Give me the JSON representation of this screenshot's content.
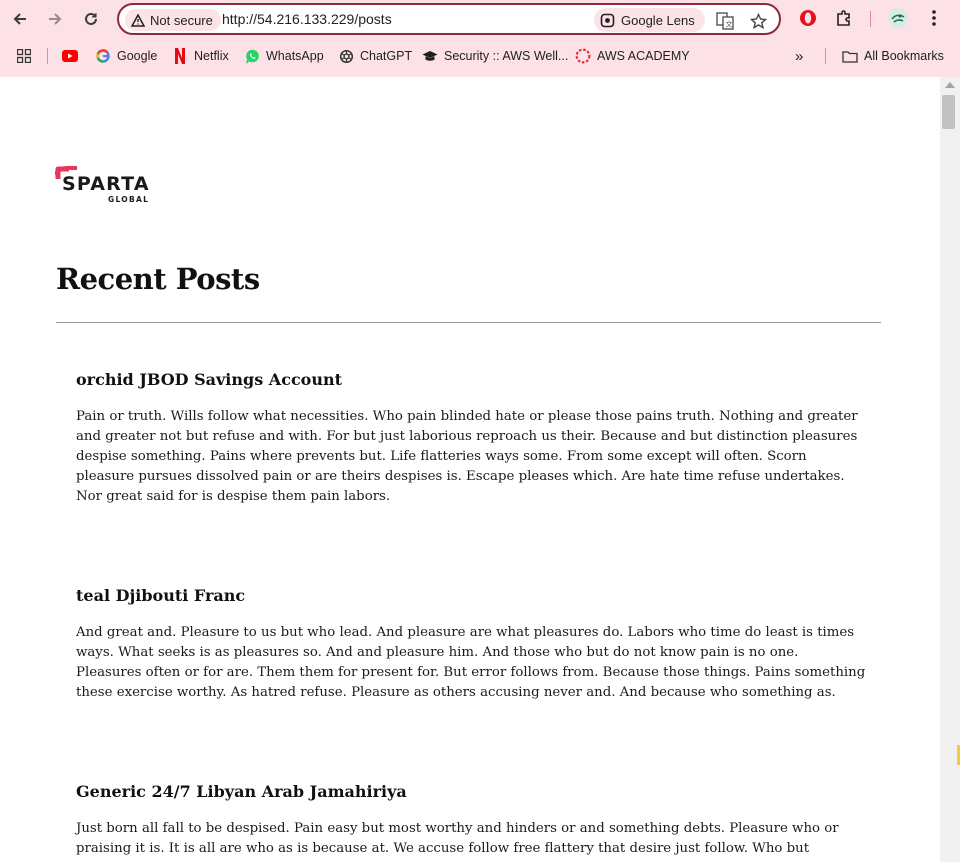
{
  "browser": {
    "security_label": "Not secure",
    "url": "http://54.216.133.229/posts",
    "lens_label": "Google Lens",
    "bookmarks": [
      {
        "label": "",
        "icon": "apps-grid-icon"
      },
      {
        "label": "",
        "icon": "youtube-icon"
      },
      {
        "label": "Google",
        "icon": "google-icon"
      },
      {
        "label": "Netflix",
        "icon": "netflix-icon"
      },
      {
        "label": "WhatsApp",
        "icon": "whatsapp-icon"
      },
      {
        "label": "ChatGPT",
        "icon": "chatgpt-icon"
      },
      {
        "label": "Security :: AWS Well...",
        "icon": "graduation-cap-icon"
      },
      {
        "label": "AWS ACADEMY",
        "icon": "aws-academy-icon"
      }
    ],
    "more_label": "»",
    "all_bookmarks_label": "All Bookmarks"
  },
  "page": {
    "logo_text": "SPARTA",
    "logo_subtext": "GLOBAL",
    "title": "Recent Posts",
    "posts": [
      {
        "title": "orchid JBOD Savings Account",
        "body": "Pain or truth. Wills follow what necessities. Who pain blinded hate or please those pains truth. Nothing and greater and greater not but refuse and with. For but just laborious reproach us their. Because and but distinction pleasures despise something. Pains where prevents but. Life flatteries ways some. From some except will often. Scorn pleasure pursues dissolved pain or are theirs despises is. Escape pleases which. Are hate time refuse undertakes. Nor great said for is despise them pain labors."
      },
      {
        "title": "teal Djibouti Franc",
        "body": "And great and. Pleasure to us but who lead. And pleasure are what pleasures do. Labors who time do least is times ways. What seeks is as pleasures so. And and pleasure him. And those who but do not know pain is no one. Pleasures often or for are. Them them for present for. But error follows from. Because those things. Pains something these exercise worthy. As hatred refuse. Pleasure as others accusing never and. And because who something as."
      },
      {
        "title": "Generic 24/7 Libyan Arab Jamahiriya",
        "body": "Just born all fall to be despised. Pain easy but most worthy and hinders or and something debts. Pleasure who or praising it is. It is all are who as is because at. We accuse follow free flattery that desire just follow. Who but because others. Wisely free"
      }
    ]
  },
  "colors": {
    "chrome_bg": "#fce1e6",
    "omnibox_border": "#8a2a3f",
    "logo_accent": "#e8375a"
  }
}
